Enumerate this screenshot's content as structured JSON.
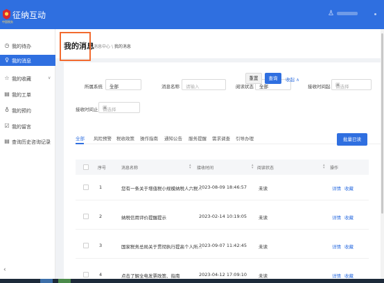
{
  "header": {
    "brand": "征纳互动",
    "logo_caption": "中国税务"
  },
  "sidebar": {
    "items": [
      {
        "icon": "clock-icon",
        "glyph": "◷",
        "label": "我的待办"
      },
      {
        "icon": "bulb-icon",
        "glyph": "♀",
        "label": "我的消息"
      },
      {
        "icon": "star-icon",
        "glyph": "☆",
        "label": "我的收藏"
      },
      {
        "icon": "ticket-icon",
        "glyph": "▤",
        "label": "我的工单"
      },
      {
        "icon": "person-icon",
        "glyph": "♁",
        "label": "我的预约"
      },
      {
        "icon": "checkbox-icon",
        "glyph": "☑",
        "label": "我的留言"
      },
      {
        "icon": "history-icon",
        "glyph": "▤",
        "label": "查询历史咨询记录"
      }
    ],
    "collapse_glyph": "‹"
  },
  "page": {
    "title": "我的消息",
    "breadcrumb": {
      "root": "消息中心",
      "sep": "\\",
      "current": "我的消息"
    }
  },
  "filters": {
    "system_label": "所属系统",
    "system_value": "全部",
    "name_label": "消息名称",
    "name_placeholder": "请输入",
    "status_label": "阅读状态",
    "status_value": "全部",
    "start_label": "接收时间起",
    "start_placeholder": "请选择",
    "end_label": "接收时间止",
    "end_placeholder": "请选择",
    "reset": "重置",
    "query": "查询",
    "collapse": "收起 ∧"
  },
  "tabs": [
    "全部",
    "风险预警",
    "税收政策",
    "操作指南",
    "通知公告",
    "服务提醒",
    "需求调查",
    "引导办理"
  ],
  "batch_read": "批量已读",
  "table": {
    "columns": [
      "序号",
      "消息名称",
      "接收时间",
      "阅读状态",
      "操作"
    ],
    "rows": [
      {
        "no": "1",
        "name": "您有一条关于增值税小规模纳税人六税...",
        "time": "2023-08-09 18:46:57",
        "status": "未读",
        "detail": "详情",
        "fav": "收藏"
      },
      {
        "no": "2",
        "name": "纳税信用评价提醒提示",
        "time": "2023-02-14 10:19:05",
        "status": "未读",
        "detail": "详情",
        "fav": "收藏"
      },
      {
        "no": "3",
        "name": "国家税务总局关于贯彻执行提高个人所...",
        "time": "2023-09-07 11:42:45",
        "status": "未读",
        "detail": "详情",
        "fav": "收藏"
      },
      {
        "no": "4",
        "name": "点击了解全电发票政策、指南",
        "time": "2023-04-12 17:09:10",
        "status": "未读",
        "detail": "详情",
        "fav": "收藏"
      }
    ]
  },
  "colors": {
    "primary": "#2f6fe0",
    "highlight_box": "#f26a2e"
  }
}
